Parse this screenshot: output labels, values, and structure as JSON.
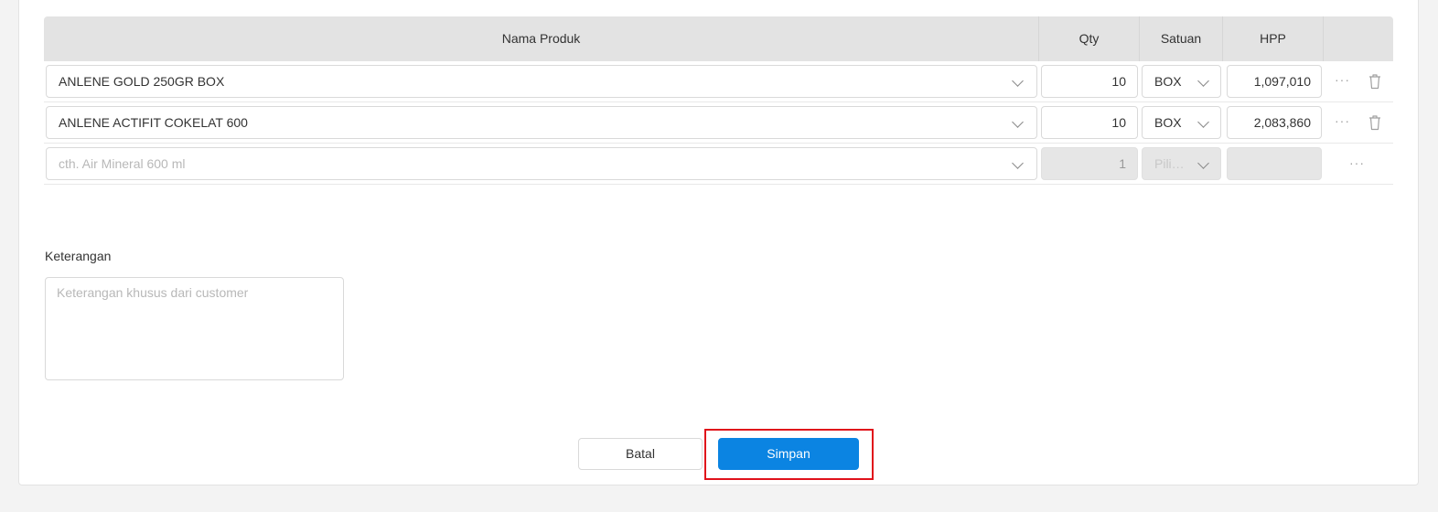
{
  "table": {
    "headers": {
      "name": "Nama Produk",
      "qty": "Qty",
      "unit": "Satuan",
      "hpp": "HPP"
    },
    "rows": [
      {
        "product": "ANLENE GOLD 250GR BOX",
        "qty": "10",
        "unit": "BOX",
        "hpp": "1,097,010",
        "more": "···"
      },
      {
        "product": "ANLENE ACTIFIT COKELAT 600",
        "qty": "10",
        "unit": "BOX",
        "hpp": "2,083,860",
        "more": "···"
      }
    ],
    "new_row": {
      "product_placeholder": "cth. Air Mineral 600 ml",
      "qty": "1",
      "unit_placeholder": "Pili…",
      "hpp": "",
      "more": "···"
    }
  },
  "notes": {
    "label": "Keterangan",
    "placeholder": "Keterangan khusus dari customer"
  },
  "actions": {
    "cancel_label": "Batal",
    "save_label": "Simpan"
  },
  "colors": {
    "primary": "#0b84e2",
    "highlight": "#e0121b",
    "header_bg": "#e3e3e3"
  }
}
